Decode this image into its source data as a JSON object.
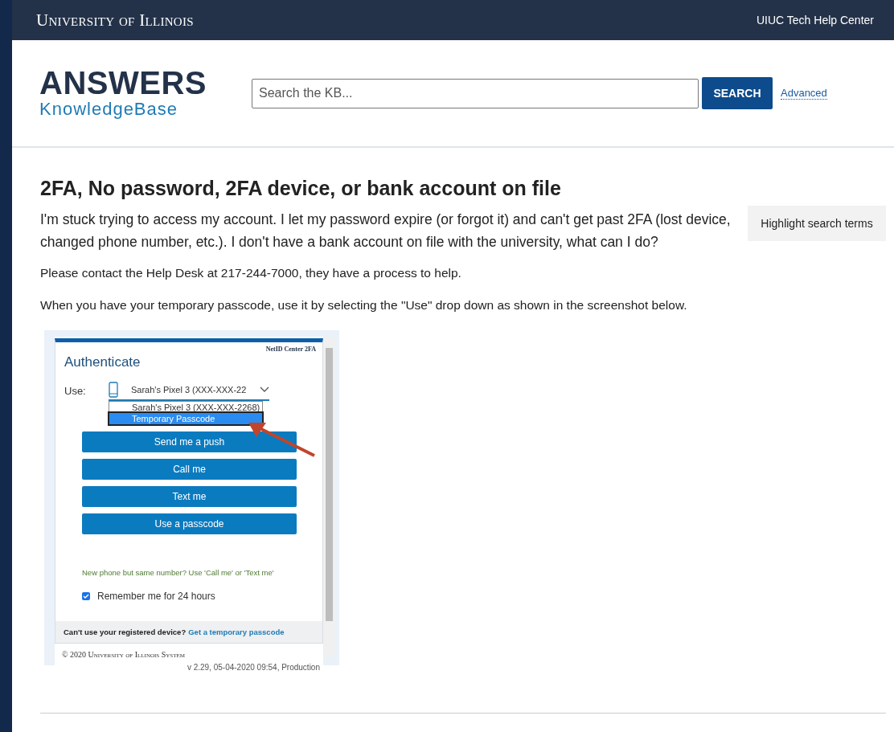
{
  "top_bar": {
    "brand": "University of Illinois",
    "link": "UIUC Tech Help Center"
  },
  "header": {
    "logo_title": "ANSWERS",
    "logo_subtitle": "KnowledgeBase",
    "search": {
      "placeholder": "Search the KB..."
    },
    "search_button": "SEARCH",
    "advanced_link": "Advanced"
  },
  "article": {
    "title": "2FA, No password, 2FA device, or bank account on file",
    "summary": "I'm stuck trying to access my account. I let my password expire (or forgot it) and can't get past 2FA (lost device, changed phone number, etc.). I don't have a bank account on file with the university, what can I do?",
    "highlight_button": "Highlight search terms",
    "paragraphs": [
      "Please contact the Help Desk at 217-244-7000, they have a process to help.",
      "When you have your temporary passcode, use it by selecting the \"Use\" drop down as shown in the screenshot below."
    ]
  },
  "screenshot": {
    "brand": "NetID Center **2FA**",
    "title": "Authenticate",
    "use_label": "Use:",
    "device_value": "Sarah's Pixel 3 (XXX-XXX-22",
    "dropdown_options": [
      {
        "label": "Sarah's Pixel 3 (XXX-XXX-2268)",
        "selected": false
      },
      {
        "label": "Temporary Passcode",
        "selected": true
      }
    ],
    "buttons": [
      "Send me a push",
      "Call me",
      "Text me",
      "Use a passcode"
    ],
    "hint": "New phone but same number? Use 'Call me' or 'Text me'",
    "remember": {
      "label": "Remember me for 24 hours",
      "checked": true
    },
    "footer_question": "Can't use your registered device?",
    "footer_link": "Get a temporary passcode",
    "copyright": "© 2020 University of Illinois System",
    "version": "v 2.29, 05-04-2020 09:54, Production"
  }
}
